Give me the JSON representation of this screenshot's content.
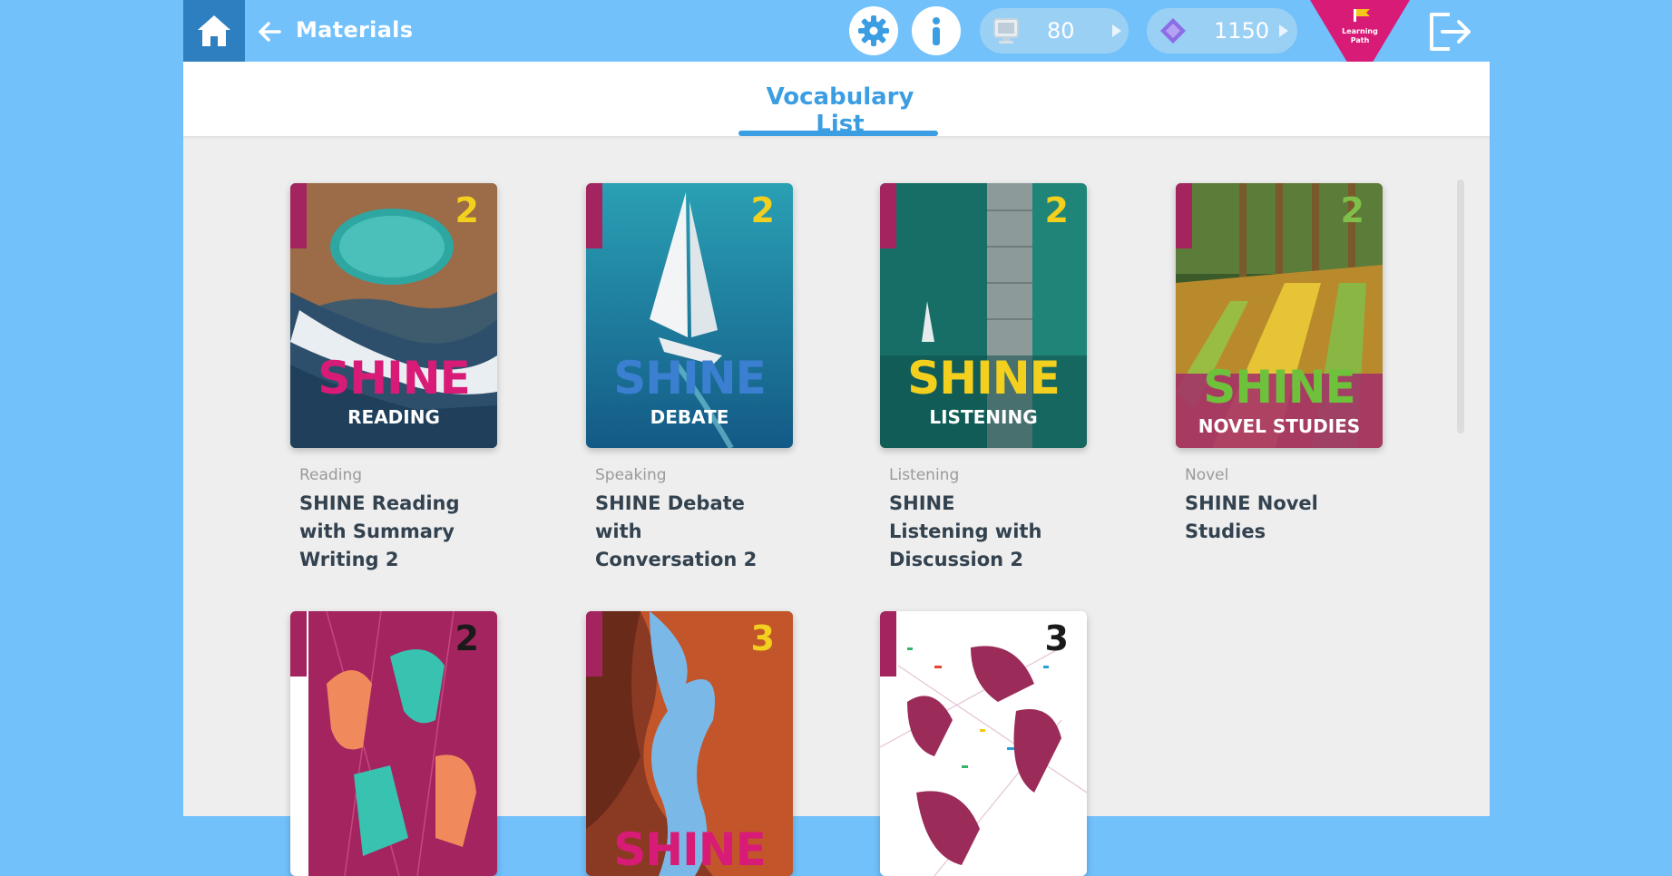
{
  "header": {
    "title": "Materials",
    "points": "80",
    "gems": "1150",
    "learning_path_line1": "Learning",
    "learning_path_line2": "Path"
  },
  "tabs": [
    {
      "label": "Vocabulary List",
      "active": true
    }
  ],
  "books": [
    {
      "category": "Reading",
      "title": "SHINE Reading with Summary Writing 2",
      "cover_word": "SHINE",
      "cover_sub": "READING",
      "grade": "2"
    },
    {
      "category": "Speaking",
      "title": "SHINE Debate with Conversation 2",
      "cover_word": "SHINE",
      "cover_sub": "DEBATE",
      "grade": "2"
    },
    {
      "category": "Listening",
      "title": "SHINE Listening with Discussion 2",
      "cover_word": "SHINE",
      "cover_sub": "LISTENING",
      "grade": "2"
    },
    {
      "category": "Novel",
      "title": "SHINE Novel Studies",
      "cover_word": "SHINE",
      "cover_sub": "NOVEL STUDIES",
      "grade": "2"
    },
    {
      "grade": "2"
    },
    {
      "cover_word": "SHINE",
      "grade": "3"
    },
    {
      "grade": "3"
    }
  ],
  "colors": {
    "background": "#72c1fb",
    "home_button": "#2e7fbf",
    "accent": "#3b9ee2",
    "learning_path": "#d81b77",
    "brand_strip": "#a3245f"
  },
  "icons": [
    "home-icon",
    "back-arrow-icon",
    "settings-gear-icon",
    "info-icon",
    "computer-icon",
    "gem-icon",
    "logout-icon"
  ]
}
